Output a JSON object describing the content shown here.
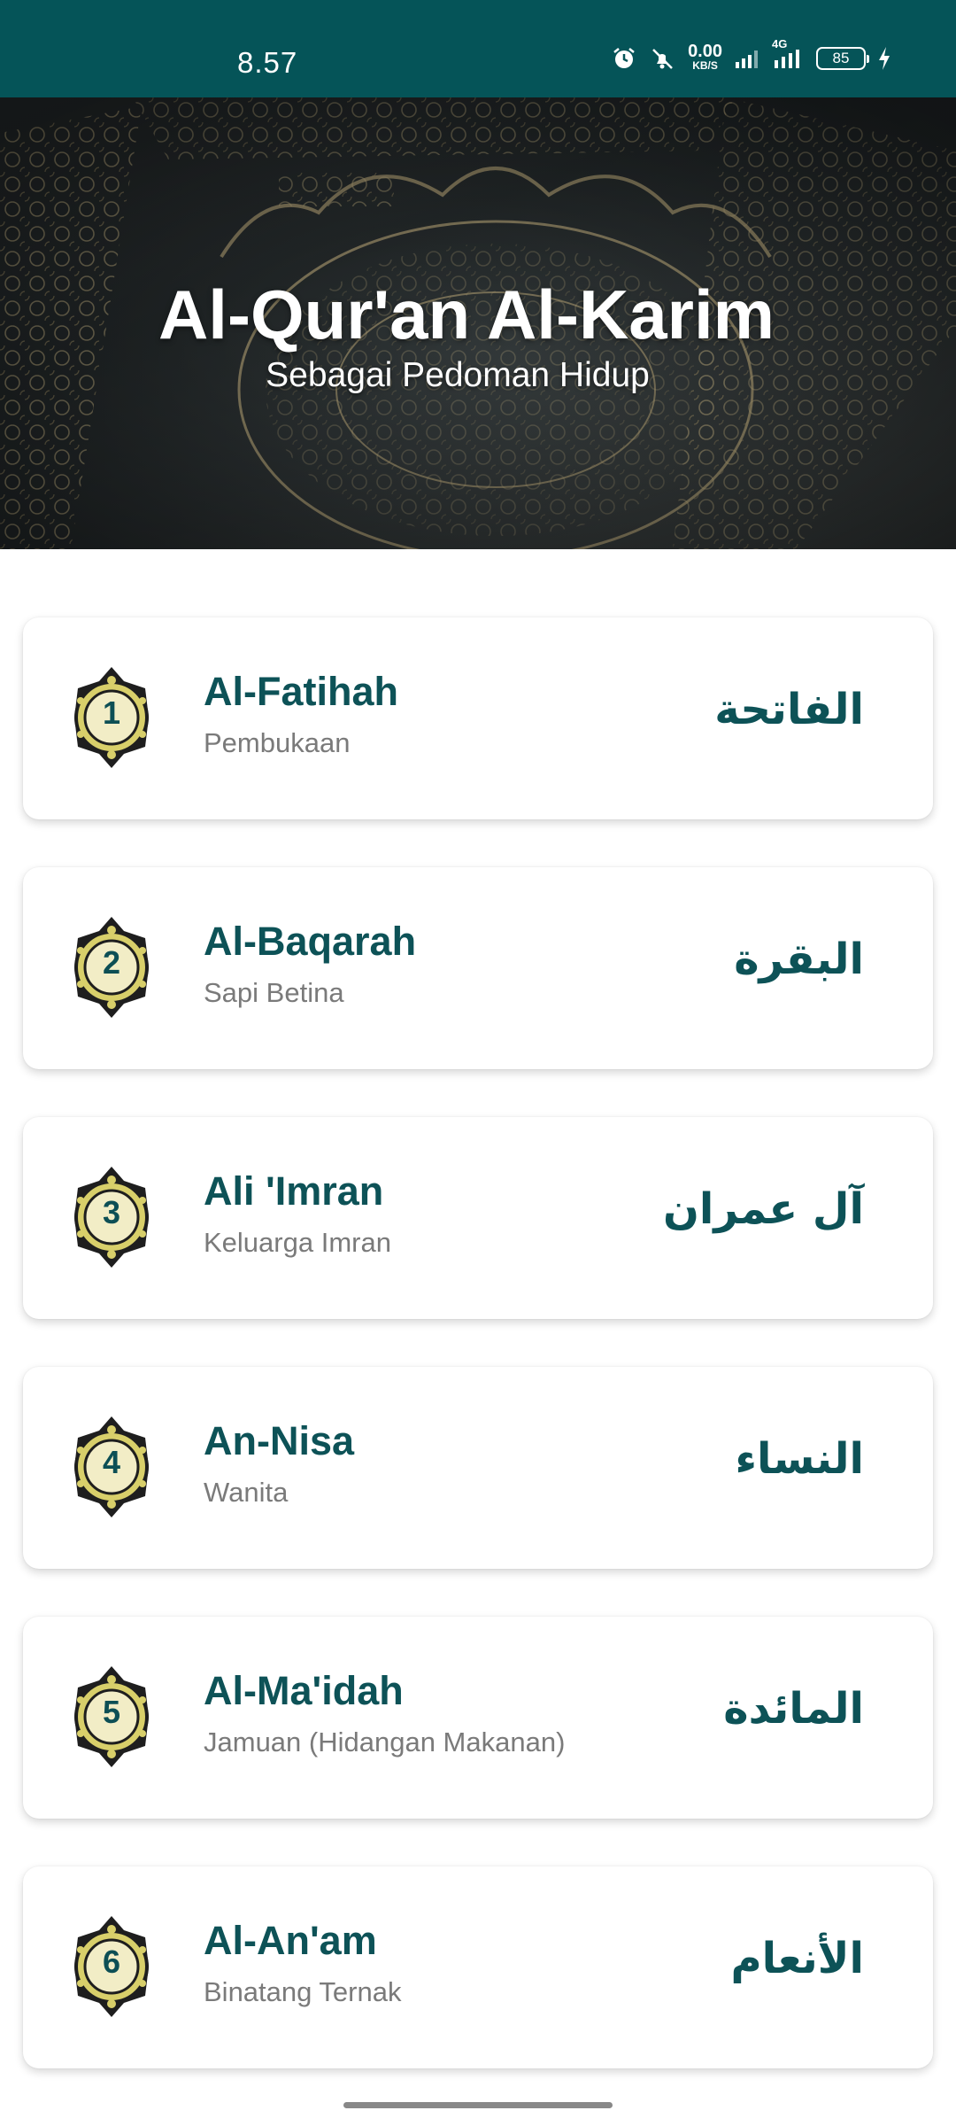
{
  "status_bar": {
    "time": "8.57",
    "net_speed_value": "0.00",
    "net_speed_unit": "KB/S",
    "network_type": "4G",
    "battery": "85",
    "bg_color": "#055458"
  },
  "header": {
    "title": "Al-Qur'an Al-Karim",
    "subtitle": "Sebagai Pedoman Hidup"
  },
  "surahs": [
    {
      "number": "1",
      "name": "Al-Fatihah",
      "meaning": "Pembukaan",
      "arabic": "الفاتحة"
    },
    {
      "number": "2",
      "name": "Al-Baqarah",
      "meaning": "Sapi Betina",
      "arabic": "البقرة"
    },
    {
      "number": "3",
      "name": "Ali 'Imran",
      "meaning": "Keluarga Imran",
      "arabic": "آل عمران"
    },
    {
      "number": "4",
      "name": "An-Nisa",
      "meaning": "Wanita",
      "arabic": "النساء"
    },
    {
      "number": "5",
      "name": "Al-Ma'idah",
      "meaning": "Jamuan (Hidangan Makanan)",
      "arabic": "المائدة"
    },
    {
      "number": "6",
      "name": "Al-An'am",
      "meaning": "Binatang Ternak",
      "arabic": "الأنعام"
    }
  ],
  "colors": {
    "accent": "#0d5257",
    "badge_gold": "#d8cf6a",
    "muted_text": "#7a7a7a"
  }
}
